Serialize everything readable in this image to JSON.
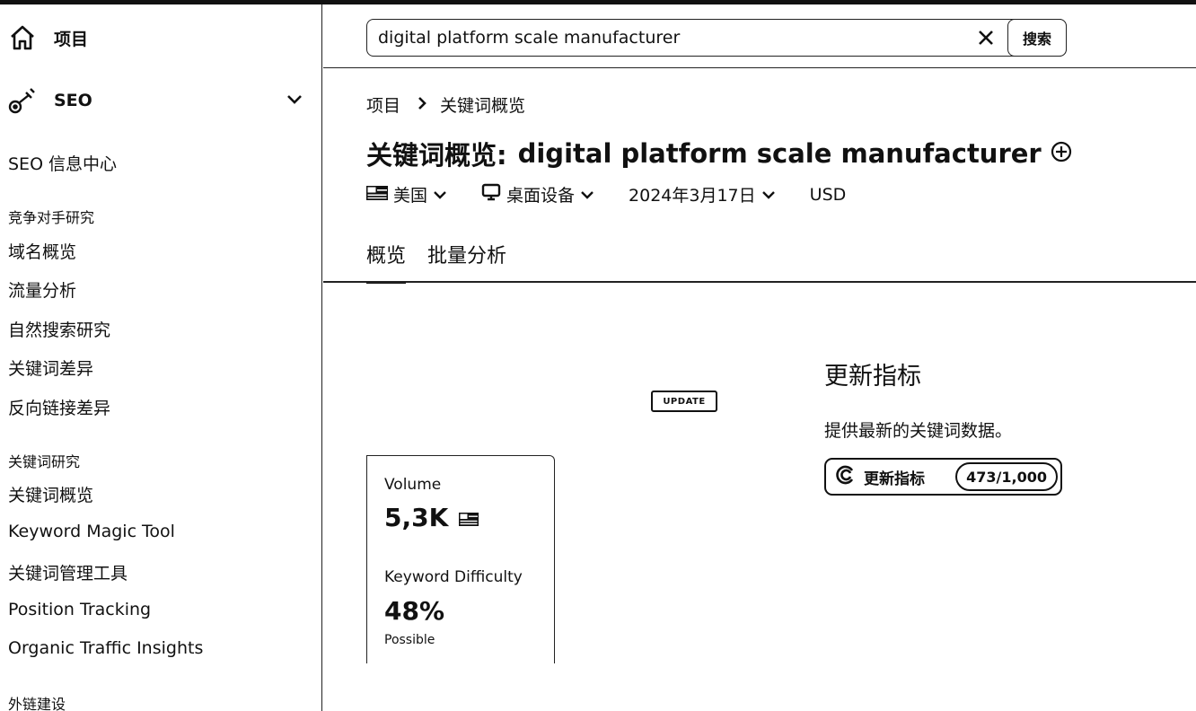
{
  "sidebar": {
    "projects_label": "项目",
    "seo_label": "SEO",
    "items": [
      {
        "label": "SEO 信息中心"
      },
      {
        "label": "竞争对手研究"
      },
      {
        "label": "域名概览"
      },
      {
        "label": "流量分析"
      },
      {
        "label": "自然搜索研究"
      },
      {
        "label": "关键词差异"
      },
      {
        "label": "反向链接差异"
      },
      {
        "label": "关键词研究"
      },
      {
        "label": "关键词概览"
      },
      {
        "label": "Keyword Magic Tool"
      },
      {
        "label": "关键词管理工具"
      },
      {
        "label": "Position Tracking"
      },
      {
        "label": "Organic Traffic Insights"
      },
      {
        "label": "外链建设"
      }
    ]
  },
  "search": {
    "value": "digital platform scale manufacturer",
    "button_label": "搜索"
  },
  "breadcrumb": {
    "root": "项目",
    "current": "关键词概览"
  },
  "page": {
    "title_prefix": "关键词概览:",
    "keyword": "digital platform scale manufacturer"
  },
  "filters": {
    "country": "美国",
    "device": "桌面设备",
    "date": "2024年3月17日",
    "currency": "USD"
  },
  "tabs": [
    {
      "label": "概览"
    },
    {
      "label": "批量分析"
    }
  ],
  "badge": "UPDATE",
  "metrics": {
    "volume_label": "Volume",
    "volume_value": "5,3K",
    "kd_label": "Keyword Difficulty",
    "kd_value": "48%",
    "kd_sub": "Possible"
  },
  "update_panel": {
    "title": "更新指标",
    "description": "提供最新的关键词数据。",
    "button_label": "更新指标",
    "counter": "473/1,000"
  }
}
